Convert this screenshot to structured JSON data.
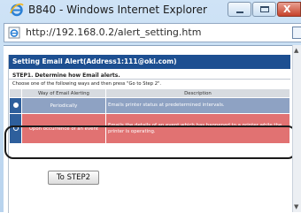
{
  "window": {
    "title": "B840 - Windows Internet Explorer",
    "controls": {
      "close_glyph": "X"
    }
  },
  "address_bar": {
    "url": "http://192.168.0.2/alert_setting.htm"
  },
  "page": {
    "header": "Setting Email Alert(Address1:111@oki.com)",
    "step_title": "STEP1. Determine how Email alerts.",
    "instruction": "Choose one of the following ways and then press \"Go to Step 2\".",
    "table": {
      "headers": [
        "Way of Email Alerting",
        "Description"
      ],
      "rows": [
        {
          "way": "Periodically",
          "description": "Emails printer status at predetermined intervals.",
          "selected": true
        },
        {
          "way": "Upon occurrence of an event",
          "description": "Emails the details of an event which has happened to a printer while the printer is operating.",
          "selected": false
        }
      ]
    },
    "next_button": "To STEP2"
  },
  "colors": {
    "header_blue": "#1d4f91",
    "row_periodic": "#8ea2c3",
    "row_event": "#e17272"
  }
}
